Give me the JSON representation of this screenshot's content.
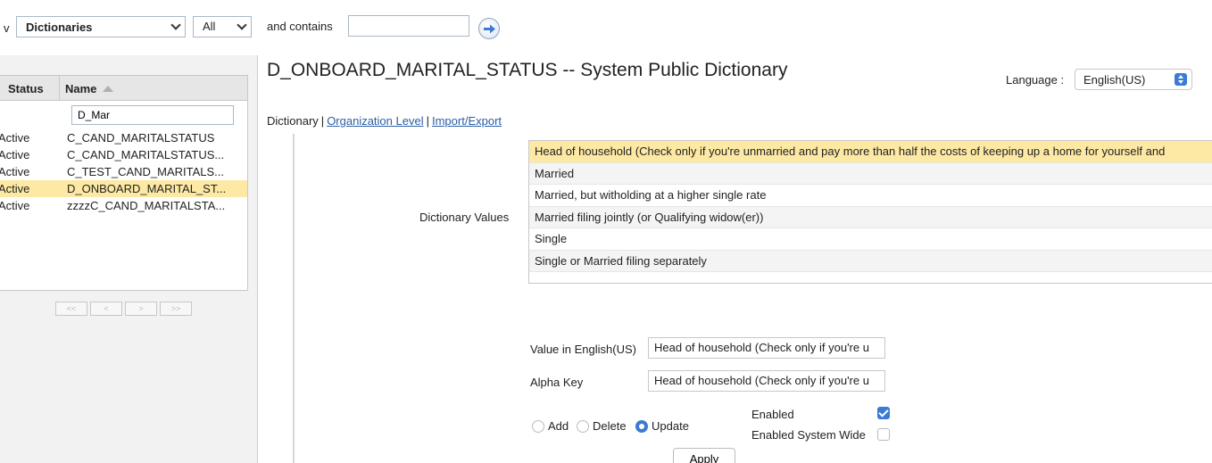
{
  "toolbar": {
    "left_cut_text": "v",
    "dictionary_type": "Dictionaries",
    "status_filter": "All",
    "contains_label": "and contains",
    "contains_value": ""
  },
  "list": {
    "header_status": "Status",
    "header_name": "Name",
    "filter_value": "D_Mar",
    "rows": [
      {
        "status": "Active",
        "name": "C_CAND_MARITALSTATUS"
      },
      {
        "status": "Active",
        "name": "C_CAND_MARITALSTATUS..."
      },
      {
        "status": "Active",
        "name": "C_TEST_CAND_MARITALS..."
      },
      {
        "status": "Active",
        "name": "D_ONBOARD_MARITAL_ST..."
      },
      {
        "status": "Active",
        "name": "zzzzC_CAND_MARITALSTA..."
      }
    ],
    "selected_index": 3,
    "pager": [
      "<<",
      "<",
      ">",
      ">>"
    ]
  },
  "main": {
    "title": "D_ONBOARD_MARITAL_STATUS -- System Public Dictionary",
    "language_label": "Language :",
    "language_value": "English(US)",
    "subnav": {
      "dictionary": "Dictionary",
      "organization_level": "Organization Level",
      "import_export": "Import/Export"
    },
    "dictionary_values_label": "Dictionary Values",
    "values": [
      "Head of household (Check only if you're unmarried and pay more than half the costs of keeping up a home for yourself and",
      "Married",
      "Married, but witholding at a higher single rate",
      "Married filing jointly (or Qualifying widow(er))",
      "Single",
      "Single or Married filing separately"
    ],
    "selected_value_index": 0,
    "value_in_label": "Value in English(US)",
    "value_in_value": "Head of household (Check only if you're u",
    "alpha_key_label": "Alpha Key",
    "alpha_key_value": "Head of household (Check only if you're u",
    "mode": {
      "add": "Add",
      "delete": "Delete",
      "update": "Update",
      "selected": "update"
    },
    "enabled_label": "Enabled",
    "enabled_checked": true,
    "enabled_system_wide_label": "Enabled System Wide",
    "enabled_system_wide_checked": false,
    "apply_label": "Apply"
  },
  "colors": {
    "selection": "#fde9a4",
    "accent": "#3a7bd5",
    "link": "#2a5ea6"
  }
}
